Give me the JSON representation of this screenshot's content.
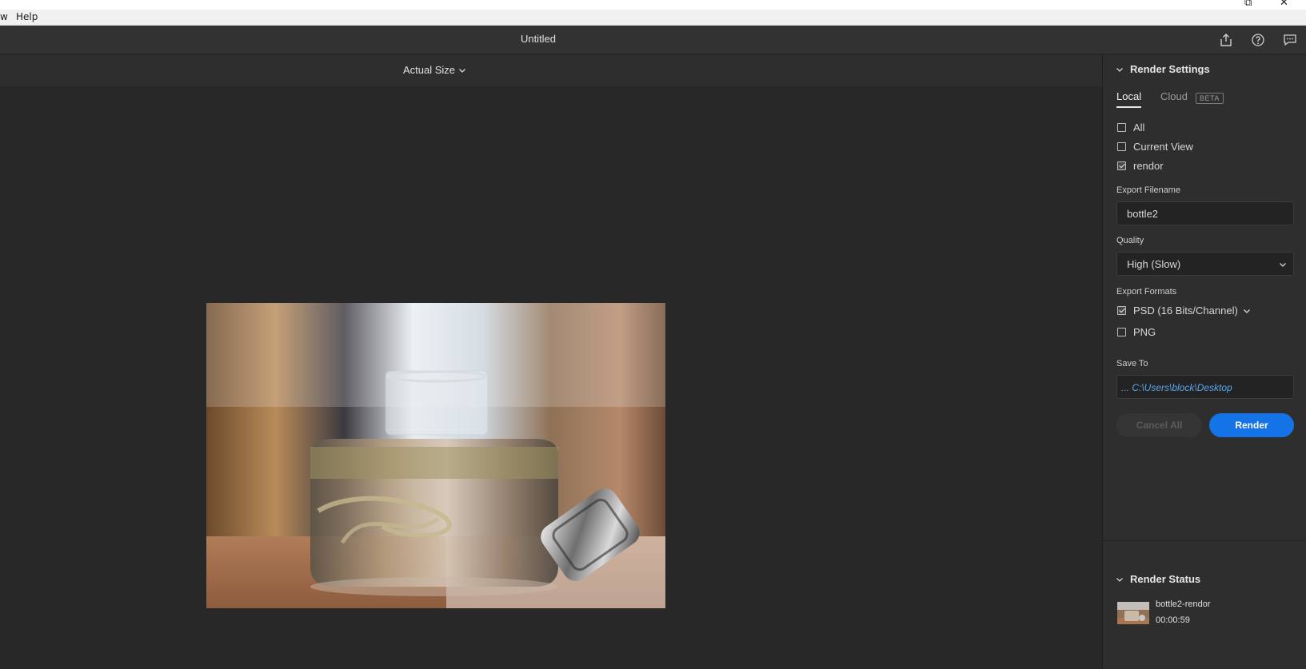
{
  "menu": {
    "items": [
      "w",
      "Help"
    ]
  },
  "window": {
    "title": "Untitled"
  },
  "icons": {
    "share": "share-icon",
    "help": "help-icon",
    "feedback": "feedback-icon"
  },
  "viewbar": {
    "zoom_label": "Actual Size"
  },
  "panel": {
    "render_settings": {
      "heading": "Render Settings",
      "tabs": {
        "local": "Local",
        "cloud": "Cloud",
        "beta": "BETA"
      },
      "options": [
        {
          "label": "All",
          "checked": false
        },
        {
          "label": "Current View",
          "checked": false
        },
        {
          "label": "rendor",
          "checked": true
        }
      ],
      "export_filename_label": "Export Filename",
      "export_filename_value": "bottle2",
      "quality_label": "Quality",
      "quality_value": "High (Slow)",
      "export_formats_label": "Export Formats",
      "formats": [
        {
          "label": "PSD (16 Bits/Channel)",
          "checked": true
        },
        {
          "label": "PNG",
          "checked": false
        }
      ],
      "save_to_label": "Save To",
      "save_to_value": "... C:\\Users\\block\\Desktop",
      "cancel_label": "Cancel All",
      "render_label": "Render"
    },
    "render_status": {
      "heading": "Render Status",
      "item_name": "bottle2-rendor",
      "item_time": "00:00:59"
    }
  },
  "colors": {
    "accent": "#1473e6",
    "path_link": "#5aa7f0",
    "panel_bg": "#2e2e2e",
    "canvas_bg": "#282828"
  }
}
